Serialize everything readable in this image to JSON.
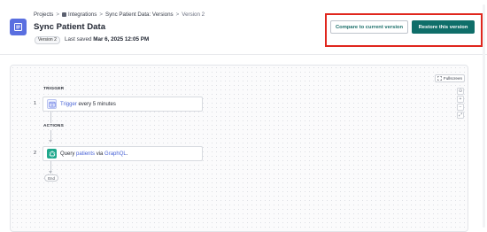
{
  "breadcrumb": {
    "items": [
      "Projects",
      "Integrations",
      "Sync Patient Data: Versions"
    ],
    "current": "Version 2",
    "separator": ">"
  },
  "page": {
    "title": "Sync Patient Data",
    "version_badge": "Version 2",
    "last_saved_label": "Last saved",
    "last_saved_value": "Mar 6, 2025 12:05 PM"
  },
  "actions": {
    "compare_label": "Compare to current version",
    "restore_label": "Restore this version"
  },
  "canvas": {
    "fullscreen_label": "Fullscreen",
    "zoom_controls": [
      "⊙",
      "+",
      "−",
      "⤢"
    ]
  },
  "workflow": {
    "trigger_heading": "TRIGGER",
    "actions_heading": "ACTIONS",
    "end_label": "End",
    "steps": [
      {
        "number": "1",
        "link": "Trigger",
        "text": " every 5 minutes"
      },
      {
        "number": "2",
        "prefix": "Query ",
        "link": "patients",
        "middle": " via ",
        "link2": "GraphQL",
        "suffix": "."
      }
    ]
  },
  "colors": {
    "primary": "#0f6e69",
    "link": "#4a64d6",
    "highlight": "#e0261d",
    "app_icon": "#5a6fe0",
    "graphql_icon": "#1fa88c"
  },
  "icons": {
    "app": "document-icon",
    "trigger": "clock-icon",
    "graphql": "graphql-icon",
    "fullscreen": "fullscreen-icon"
  }
}
